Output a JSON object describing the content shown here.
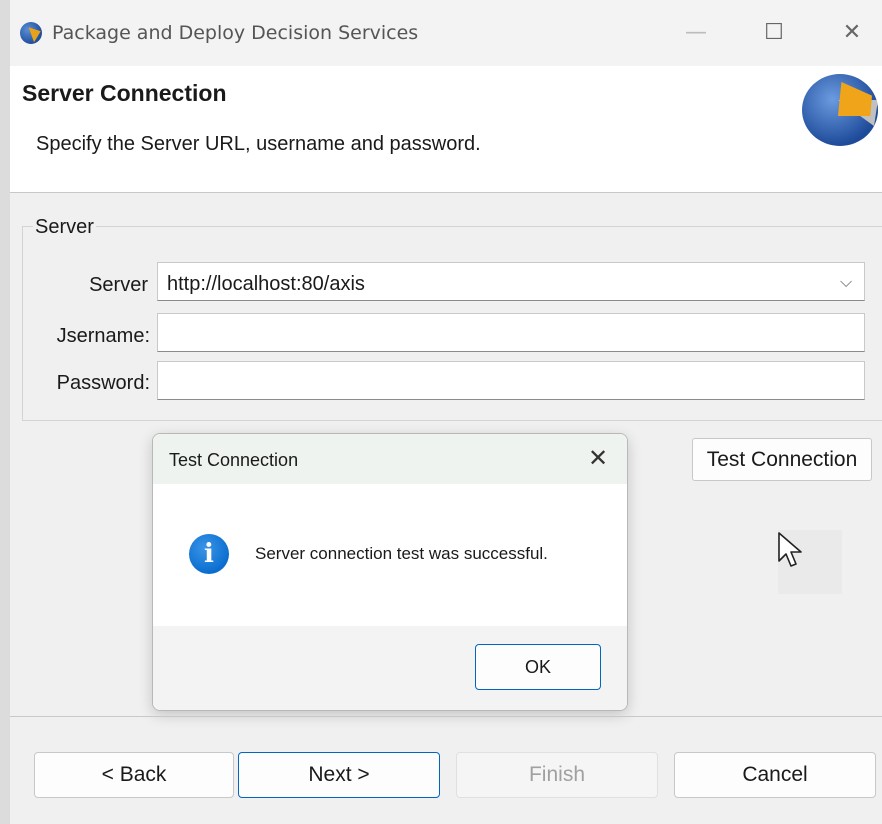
{
  "window": {
    "title": "Package and Deploy Decision Services",
    "min_glyph": "—",
    "max_glyph": "☐",
    "close_glyph": "✕"
  },
  "header": {
    "title": "Server Connection",
    "description": "Specify the Server URL, username and password."
  },
  "server_group": {
    "label": "Server",
    "server_label": "Server",
    "server_value": "http://localhost:80/axis",
    "username_label": "Jsername:",
    "username_value": "",
    "password_label": "Password:",
    "password_value": ""
  },
  "test_connection_label": "Test Connection",
  "dialog": {
    "title": "Test Connection",
    "close_glyph": "✕",
    "info_glyph": "i",
    "message": "Server connection test was successful.",
    "ok_label": "OK"
  },
  "footer": {
    "back_label": "< Back",
    "next_label": "Next >",
    "finish_label": "Finish",
    "cancel_label": "Cancel"
  },
  "colors": {
    "accent": "#0067c0",
    "info_icon": "#0b6ecf",
    "logo_blue": "#1d4a99",
    "logo_orange": "#f0a41a"
  },
  "icons": {
    "app": "app-logo-icon",
    "info": "info-icon",
    "dropdown": "chevron-down-icon",
    "cursor": "mouse-pointer-icon"
  }
}
